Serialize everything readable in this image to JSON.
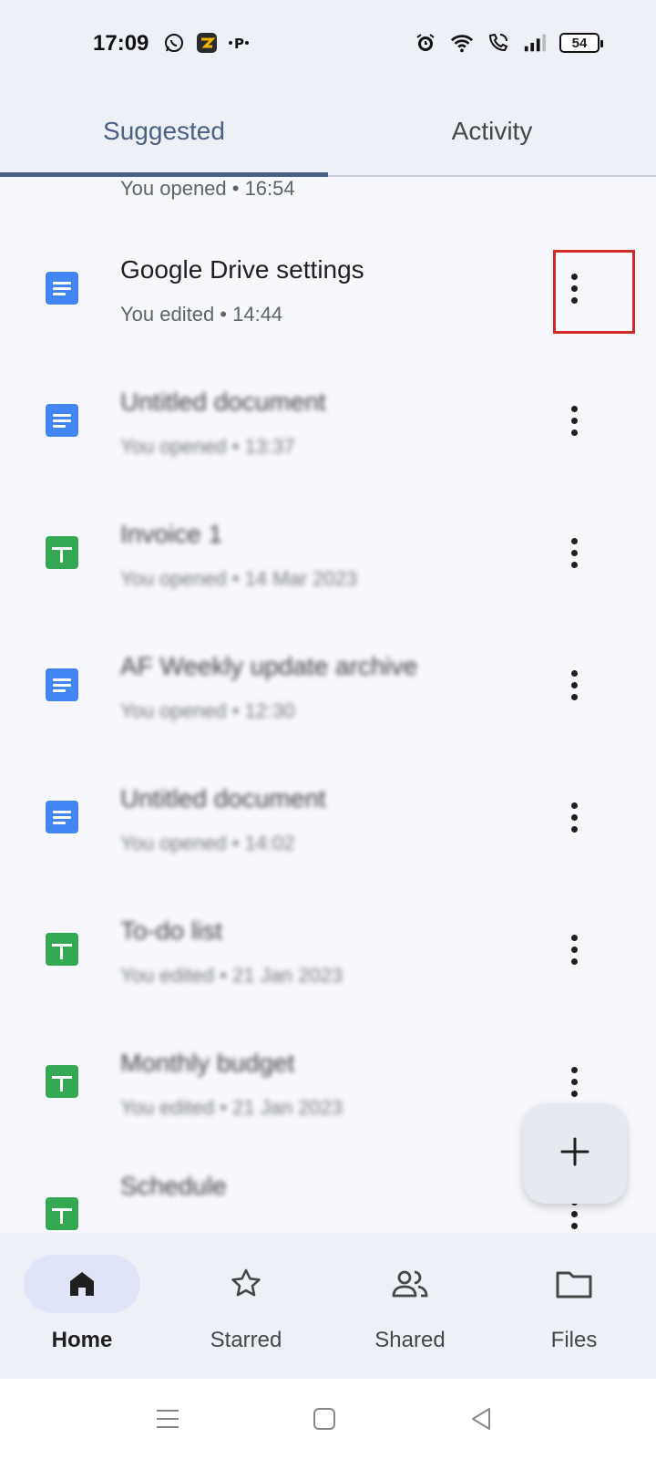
{
  "status": {
    "time": "17:09",
    "battery": "54"
  },
  "tabs": [
    {
      "label": "Suggested",
      "active": true
    },
    {
      "label": "Activity",
      "active": false
    }
  ],
  "partial_row": {
    "subtitle": "You opened • 16:54"
  },
  "files": [
    {
      "title": "Google Drive settings",
      "subtitle": "You edited • 14:44",
      "type": "doc",
      "blurred": false
    },
    {
      "title": "Untitled document",
      "subtitle": "You opened • 13:37",
      "type": "doc",
      "blurred": true
    },
    {
      "title": "Invoice 1",
      "subtitle": "You opened • 14 Mar 2023",
      "type": "sheet",
      "blurred": true
    },
    {
      "title": "AF Weekly update archive",
      "subtitle": "You opened • 12:30",
      "type": "doc",
      "blurred": true
    },
    {
      "title": "Untitled document",
      "subtitle": "You opened • 14:02",
      "type": "doc",
      "blurred": true
    },
    {
      "title": "To-do list",
      "subtitle": "You edited • 21 Jan 2023",
      "type": "sheet",
      "blurred": true
    },
    {
      "title": "Monthly budget",
      "subtitle": "You edited • 21 Jan 2023",
      "type": "sheet",
      "blurred": true
    },
    {
      "title": "Schedule",
      "subtitle": "",
      "type": "sheet",
      "blurred": true
    }
  ],
  "fab": {
    "icon": "plus-icon"
  },
  "bottom_nav": [
    {
      "label": "Home",
      "icon": "home-icon",
      "active": true
    },
    {
      "label": "Starred",
      "icon": "star-icon",
      "active": false
    },
    {
      "label": "Shared",
      "icon": "people-icon",
      "active": false
    },
    {
      "label": "Files",
      "icon": "folder-icon",
      "active": false
    }
  ],
  "colors": {
    "accent": "#4a5f85",
    "doc_blue": "#4285f4",
    "sheet_green": "#34a853",
    "highlight_red": "#d62a2a"
  }
}
